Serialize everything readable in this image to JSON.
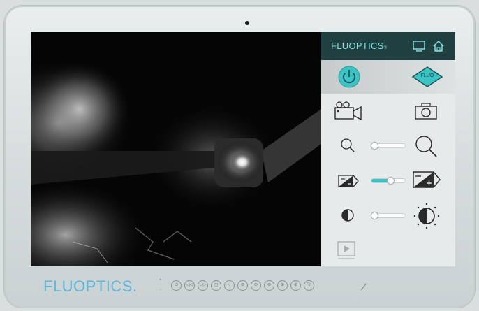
{
  "device": {
    "brand": "FLUOPTICS.",
    "panel_brand": "FLUOPTICS",
    "panel_brand_mark": "®"
  },
  "panel": {
    "header_icons": [
      "monitor-icon",
      "home-icon"
    ],
    "power_icon": "power-icon",
    "fluo_label": "FLUO",
    "controls": [
      {
        "name": "zoom",
        "left_icon": "zoom-out-icon",
        "right_icon": "zoom-in-icon",
        "level": 0.0
      },
      {
        "name": "exposure",
        "left_icon": "exposure-minus-icon",
        "right_icon": "exposure-plus-icon",
        "level": 0.6
      },
      {
        "name": "contrast",
        "left_icon": "contrast-low-icon",
        "right_icon": "contrast-high-icon",
        "level": 0.0
      }
    ],
    "record_icon": "video-camera-icon",
    "snapshot_icon": "photo-camera-icon",
    "playback_icon": "play-icon"
  },
  "bezel": {
    "buttons": [
      "⏻",
      "◁◁",
      "▷▷",
      "▢",
      "○",
      "⊖",
      "⊙",
      "⊖",
      "⊕",
      "⊛",
      "Fn"
    ],
    "side_marks": [
      "+",
      "·",
      "−"
    ]
  },
  "colors": {
    "accent": "#3cc3c6",
    "header_bg": "#1f3f40",
    "brand_blue": "#5fb5d8"
  }
}
